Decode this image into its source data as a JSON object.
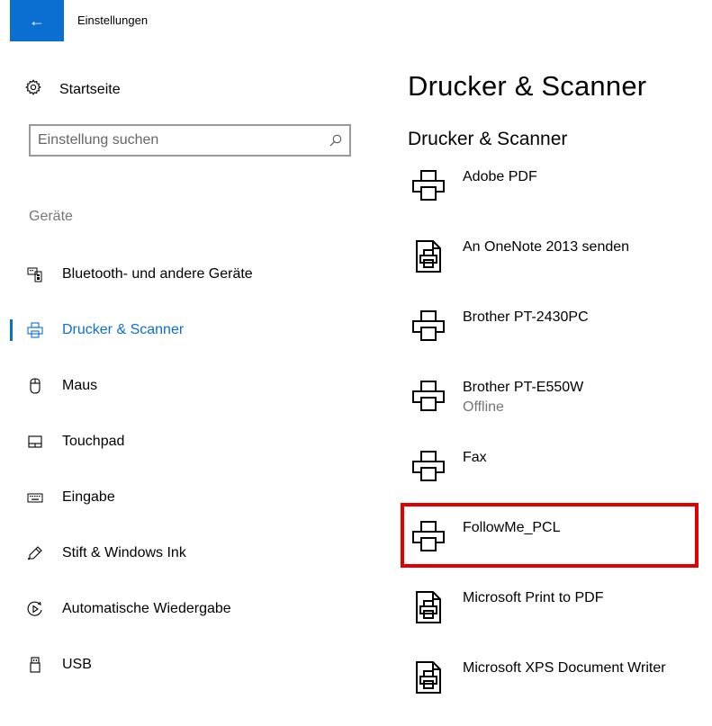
{
  "header": {
    "back_label": "←",
    "title": "Einstellungen"
  },
  "sidebar": {
    "home_label": "Startseite",
    "search_placeholder": "Einstellung suchen",
    "section": "Geräte",
    "items": [
      {
        "label": "Bluetooth- und andere Geräte",
        "icon": "bluetooth-devices-icon"
      },
      {
        "label": "Drucker & Scanner",
        "icon": "printer-icon",
        "active": true
      },
      {
        "label": "Maus",
        "icon": "mouse-icon"
      },
      {
        "label": "Touchpad",
        "icon": "touchpad-icon"
      },
      {
        "label": "Eingabe",
        "icon": "keyboard-icon"
      },
      {
        "label": "Stift & Windows Ink",
        "icon": "pen-icon"
      },
      {
        "label": "Automatische Wiedergabe",
        "icon": "autoplay-icon"
      },
      {
        "label": "USB",
        "icon": "usb-icon"
      }
    ]
  },
  "main": {
    "title": "Drucker & Scanner",
    "subtitle": "Drucker & Scanner",
    "printers": [
      {
        "name": "Adobe PDF",
        "status": "",
        "icon": "printer-icon"
      },
      {
        "name": "An OneNote 2013 senden",
        "status": "",
        "icon": "document-printer-icon"
      },
      {
        "name": "Brother PT-2430PC",
        "status": "",
        "icon": "printer-icon"
      },
      {
        "name": "Brother PT-E550W",
        "status": "Offline",
        "icon": "printer-icon"
      },
      {
        "name": "Fax",
        "status": "",
        "icon": "printer-icon"
      },
      {
        "name": "FollowMe_PCL",
        "status": "",
        "icon": "printer-icon",
        "highlighted": true
      },
      {
        "name": "Microsoft Print to PDF",
        "status": "",
        "icon": "document-printer-icon"
      },
      {
        "name": "Microsoft XPS Document Writer",
        "status": "",
        "icon": "document-printer-icon"
      }
    ]
  },
  "colors": {
    "accent": "#0a6fd0",
    "highlight": "#e00000",
    "secondary_text": "#767676"
  }
}
